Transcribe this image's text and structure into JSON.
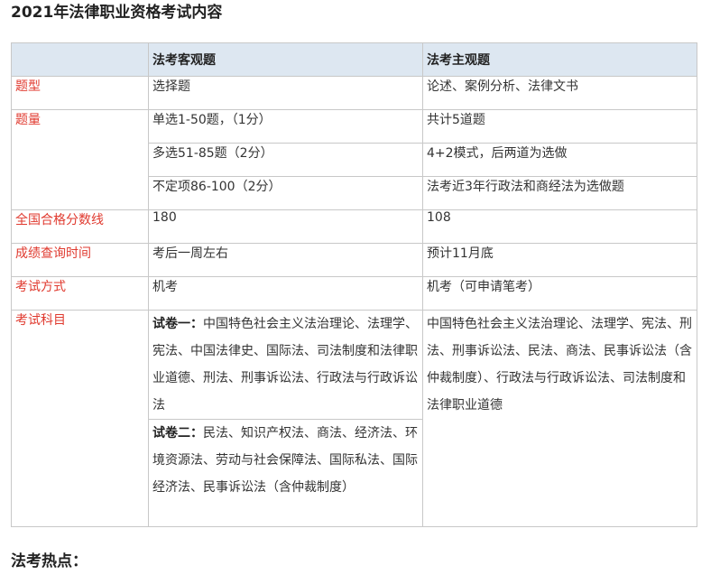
{
  "page_title": "2021年法律职业资格考试内容",
  "section_hot_title": "法考热点：",
  "table": {
    "headers": [
      "",
      "法考客观题",
      "法考主观题"
    ],
    "rows": {
      "type": {
        "label": "题型",
        "objective": "选择题",
        "subjective": "论述、案例分析、法律文书"
      },
      "quantity": {
        "label": "题量",
        "objective": [
          "单选1-50题，（1分）",
          "多选51-85题（2分）",
          "不定项86-100（2分）"
        ],
        "subjective": [
          "共计5道题",
          "4+2模式，后两道为选做",
          "法考近3年行政法和商经法为选做题"
        ]
      },
      "pass_score": {
        "label": "全国合格分数线",
        "objective": "180",
        "subjective": "108"
      },
      "score_query": {
        "label": "成绩查询时间",
        "objective": "考后一周左右",
        "subjective": "预计11月底"
      },
      "exam_mode": {
        "label": "考试方式",
        "objective": "机考",
        "subjective": "机考（可申请笔考）"
      },
      "subjects": {
        "label": "考试科目",
        "paper1_lead": "试卷一：",
        "paper1_text": "中国特色社会主义法治理论、法理学、宪法、中国法律史、国际法、司法制度和法律职业道德、刑法、刑事诉讼法、行政法与行政诉讼法",
        "paper2_lead": "试卷二：",
        "paper2_text": "民法、知识产权法、商法、经济法、环境资源法、劳动与社会保障法、国际私法、国际经济法、民事诉讼法（含仲裁制度）",
        "subjective": "中国特色社会主义法治理论、法理学、宪法、刑法、刑事诉讼法、民法、商法、民事诉讼法（含仲裁制度）、行政法与行政诉讼法、司法制度和法律职业道德"
      }
    }
  },
  "colors": {
    "label_red": "#e03a2f",
    "header_bg": "#dde7f1",
    "border": "#c8c8c8"
  }
}
